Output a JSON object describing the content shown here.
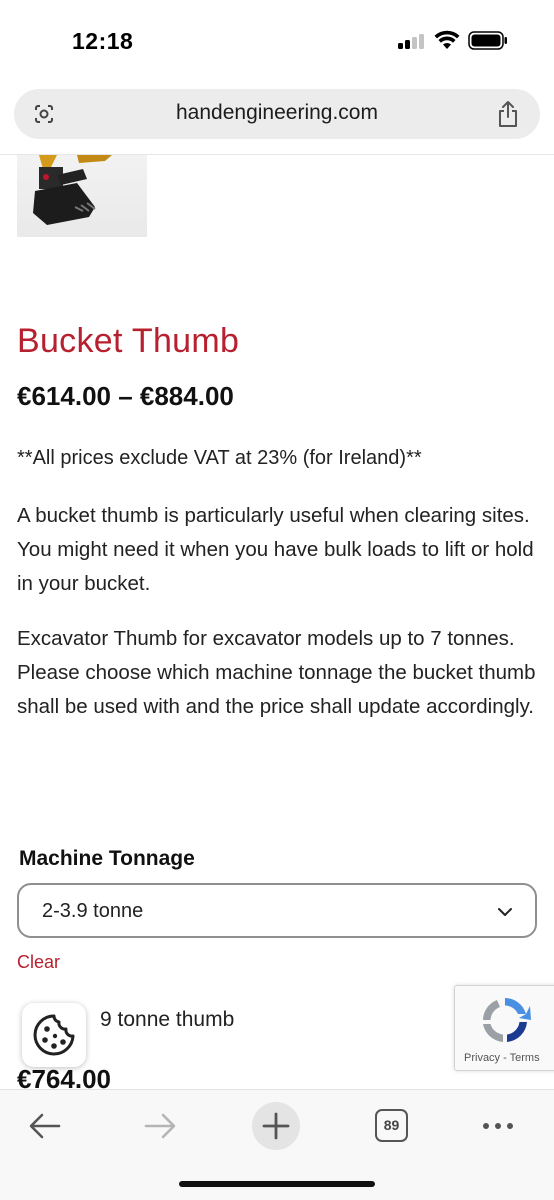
{
  "status_bar": {
    "time": "12:18"
  },
  "browser": {
    "url": "handengineering.com",
    "tab_count": "89"
  },
  "product": {
    "title": "Bucket Thumb",
    "price_range": "€614.00 – €884.00",
    "vat_note": "**All prices exclude VAT at 23% (for Ireland)**",
    "description_1": "A bucket thumb is particularly useful when clearing sites. You might need it when you have bulk loads to lift or hold in your bucket.",
    "description_2": "Excavator Thumb for excavator models up to 7 tonnes. Please choose which machine tonnage the bucket thumb shall be used with and the price shall update accordingly."
  },
  "variation": {
    "label": "Machine Tonnage",
    "selected_value": "2-3.9 tonne",
    "clear_label": "Clear",
    "selected_name_partial": "9 tonne thumb",
    "price": "€764.00"
  },
  "recaptcha": {
    "links": "Privacy - Terms"
  },
  "colors": {
    "accent": "#b7202e",
    "text": "#1a1a1a",
    "url_bar": "#ececec"
  },
  "icons": [
    "lens-icon",
    "share-icon",
    "chevron-down-icon",
    "cookie-icon",
    "recaptcha-logo",
    "back-arrow-icon",
    "forward-arrow-icon",
    "plus-icon",
    "more-icon"
  ]
}
